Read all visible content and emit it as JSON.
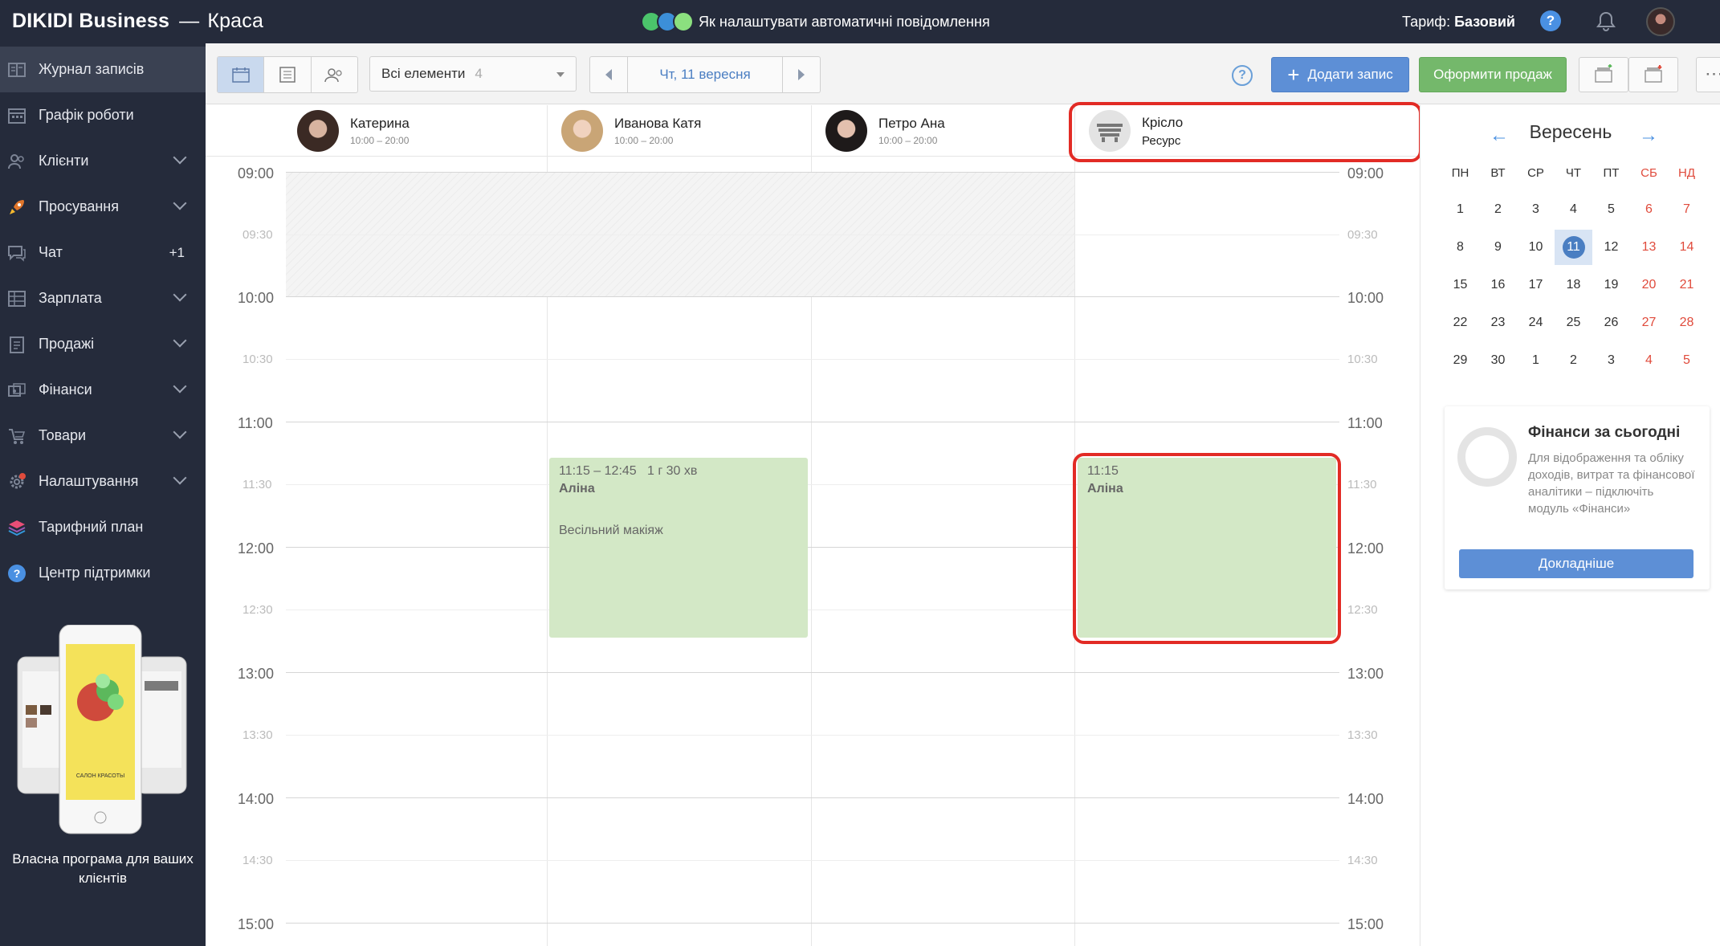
{
  "header": {
    "brand": "DIKIDI Business",
    "separator": "—",
    "company": "Краса",
    "promo_text": "Як налаштувати автоматичні повідомлення",
    "tariff_label": "Тариф:",
    "tariff_value": "Базовий",
    "help": "?"
  },
  "sidebar": {
    "items": [
      {
        "label": "Журнал записів",
        "icon": "journal-icon"
      },
      {
        "label": "Графік роботи",
        "icon": "schedule-icon"
      },
      {
        "label": "Клієнти",
        "icon": "clients-icon"
      },
      {
        "label": "Просування",
        "icon": "rocket-icon"
      },
      {
        "label": "Чат",
        "icon": "chat-icon",
        "count": "+1"
      },
      {
        "label": "Зарплата",
        "icon": "salary-icon"
      },
      {
        "label": "Продажі",
        "icon": "sales-icon"
      },
      {
        "label": "Фінанси",
        "icon": "finance-icon"
      },
      {
        "label": "Товари",
        "icon": "goods-icon"
      },
      {
        "label": "Налаштування",
        "icon": "settings-icon"
      },
      {
        "label": "Тарифний план",
        "icon": "layers-icon"
      },
      {
        "label": "Центр підтримки",
        "icon": "help-icon"
      }
    ],
    "promo_text": "Власна програма для ваших клієнтів",
    "phone_caption": "САЛОН КРАСОТЫ"
  },
  "toolbar": {
    "filter_label": "Всі елементи",
    "filter_count": "4",
    "date": "Чт, 11 вересня",
    "help": "?",
    "add_label": "Додати запис",
    "sale_label": "Оформити продаж",
    "more": "···"
  },
  "columns": [
    {
      "name": "Катерина",
      "hours": "10:00 – 20:00"
    },
    {
      "name": "Иванова Катя",
      "hours": "10:00 – 20:00"
    },
    {
      "name": "Петро Ана",
      "hours": "10:00 – 20:00"
    },
    {
      "name": "Крісло",
      "hours": "Ресурс"
    }
  ],
  "time_labels": [
    "09:00",
    "09:30",
    "10:00",
    "10:30",
    "11:00",
    "11:30",
    "12:00",
    "12:30",
    "13:00",
    "13:30",
    "14:00",
    "14:30",
    "15:00"
  ],
  "appointments": [
    {
      "time": "11:15 – 12:45",
      "duration": "1 г 30 хв",
      "client": "Аліна",
      "service": "Весільний макіяж"
    },
    {
      "time": "11:15",
      "client": "Аліна"
    }
  ],
  "calendar": {
    "month": "Вересень",
    "weekdays": [
      "ПН",
      "ВТ",
      "СР",
      "ЧТ",
      "ПТ",
      "СБ",
      "НД"
    ],
    "weeks": [
      [
        "1",
        "2",
        "3",
        "4",
        "5",
        "6",
        "7"
      ],
      [
        "8",
        "9",
        "10",
        "11",
        "12",
        "13",
        "14"
      ],
      [
        "15",
        "16",
        "17",
        "18",
        "19",
        "20",
        "21"
      ],
      [
        "22",
        "23",
        "24",
        "25",
        "26",
        "27",
        "28"
      ],
      [
        "29",
        "30",
        "1",
        "2",
        "3",
        "4",
        "5"
      ]
    ],
    "selected": "11"
  },
  "finance_card": {
    "title": "Фінанси за сьогодні",
    "description": "Для відображення та обліку доходів, витрат та фінансової аналітики – підключіть модуль «Фінанси»",
    "button": "Докладніше"
  },
  "colors": {
    "sidebar_bg": "#252b3b",
    "accent_blue": "#5d8fd6",
    "accent_green": "#74b86b",
    "appointment_bg": "#d3e8c6",
    "highlight_red": "#e22b25",
    "weekend_red": "#e04b3c"
  }
}
